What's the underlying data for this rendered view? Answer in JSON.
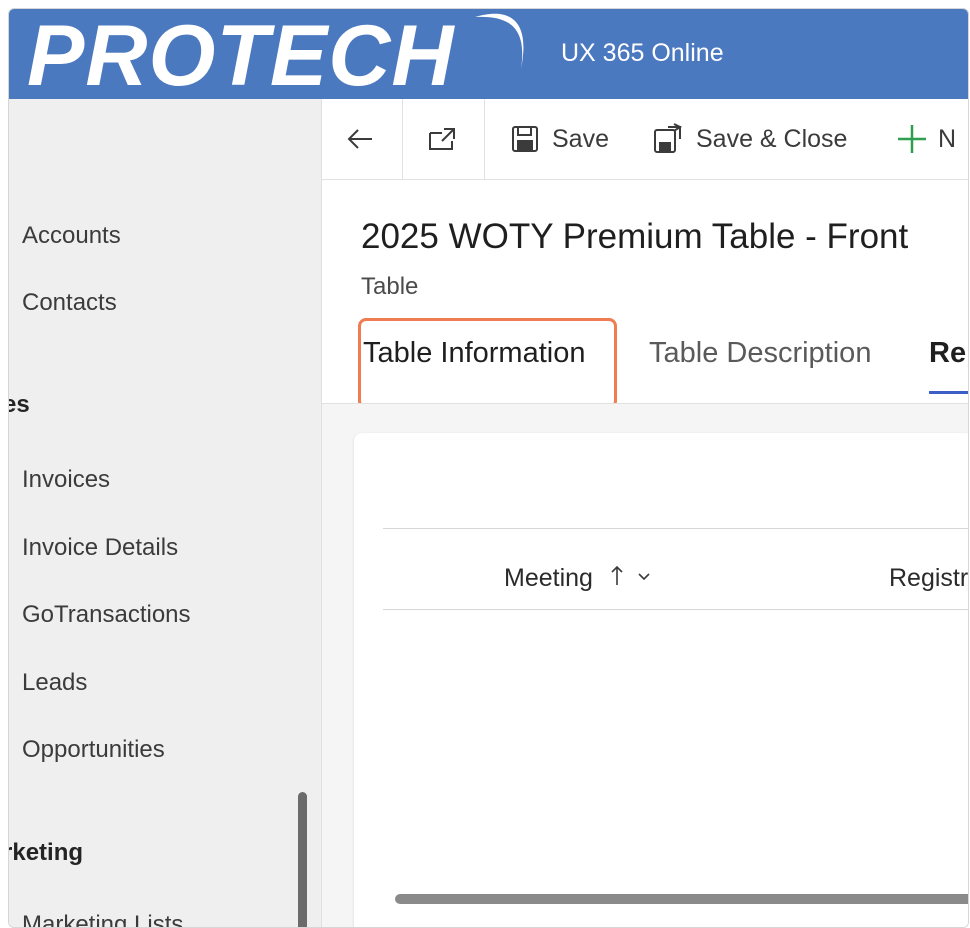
{
  "header": {
    "logo_text": "PROTECH",
    "app_title": "UX 365 Online",
    "background_color": "#4b79c0"
  },
  "sidebar": {
    "items": [
      {
        "label": "Accounts",
        "type": "item"
      },
      {
        "label": "Contacts",
        "type": "item"
      },
      {
        "label": "es",
        "type": "group"
      },
      {
        "label": "Invoices",
        "type": "item"
      },
      {
        "label": "Invoice Details",
        "type": "item"
      },
      {
        "label": "GoTransactions",
        "type": "item"
      },
      {
        "label": "Leads",
        "type": "item"
      },
      {
        "label": "Opportunities",
        "type": "item"
      },
      {
        "label": "rketing",
        "type": "group"
      },
      {
        "label": "Marketing Lists",
        "type": "item"
      }
    ]
  },
  "command_bar": {
    "back_icon": "back-arrow-icon",
    "popout_icon": "open-in-new-window-icon",
    "save_label": "Save",
    "save_close_label": "Save & Close",
    "new_label": "N"
  },
  "record": {
    "title": "2025 WOTY Premium Table - Front",
    "entity": "Table"
  },
  "tabs": [
    {
      "label": "Table Information",
      "active": true
    },
    {
      "label": "Table Description",
      "active": false
    },
    {
      "label": "Re",
      "active": false
    }
  ],
  "grid": {
    "columns": [
      {
        "label": "Meeting",
        "sort": "ascending"
      },
      {
        "label": "Registr"
      }
    ]
  },
  "colors": {
    "highlight": "#f07c52",
    "accent": "#3b5fc7",
    "new_plus": "#2e9e4f"
  }
}
